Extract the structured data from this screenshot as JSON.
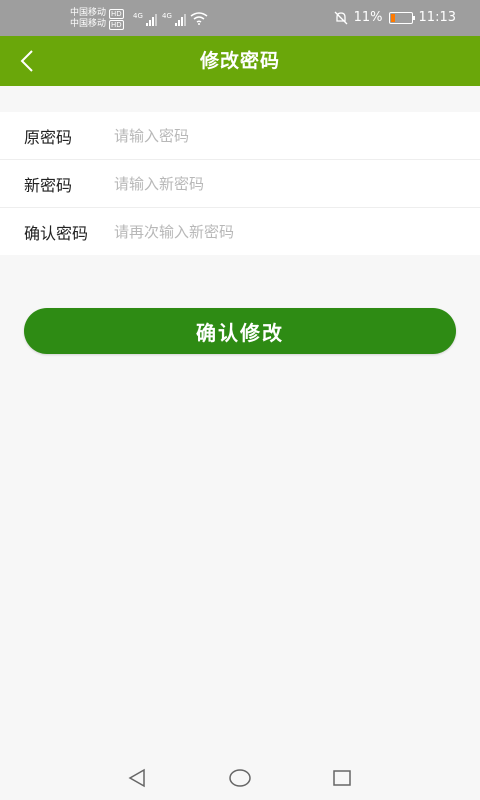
{
  "status": {
    "carrier1": "中国移动",
    "carrier2": "中国移动",
    "hd": "HD",
    "net1": "4G",
    "net2": "4G",
    "battery": "11%",
    "time": "11:13"
  },
  "header": {
    "title": "修改密码"
  },
  "form": {
    "fields": [
      {
        "label": "原密码",
        "placeholder": "请输入密码"
      },
      {
        "label": "新密码",
        "placeholder": "请输入新密码"
      },
      {
        "label": "确认密码",
        "placeholder": "请再次输入新密码"
      }
    ]
  },
  "actions": {
    "confirm_label": "确认修改"
  },
  "colors": {
    "status_bar": "#9e9e9e",
    "title_bar": "#6aa70a",
    "button": "#2e8b14",
    "background": "#f7f7f7"
  }
}
